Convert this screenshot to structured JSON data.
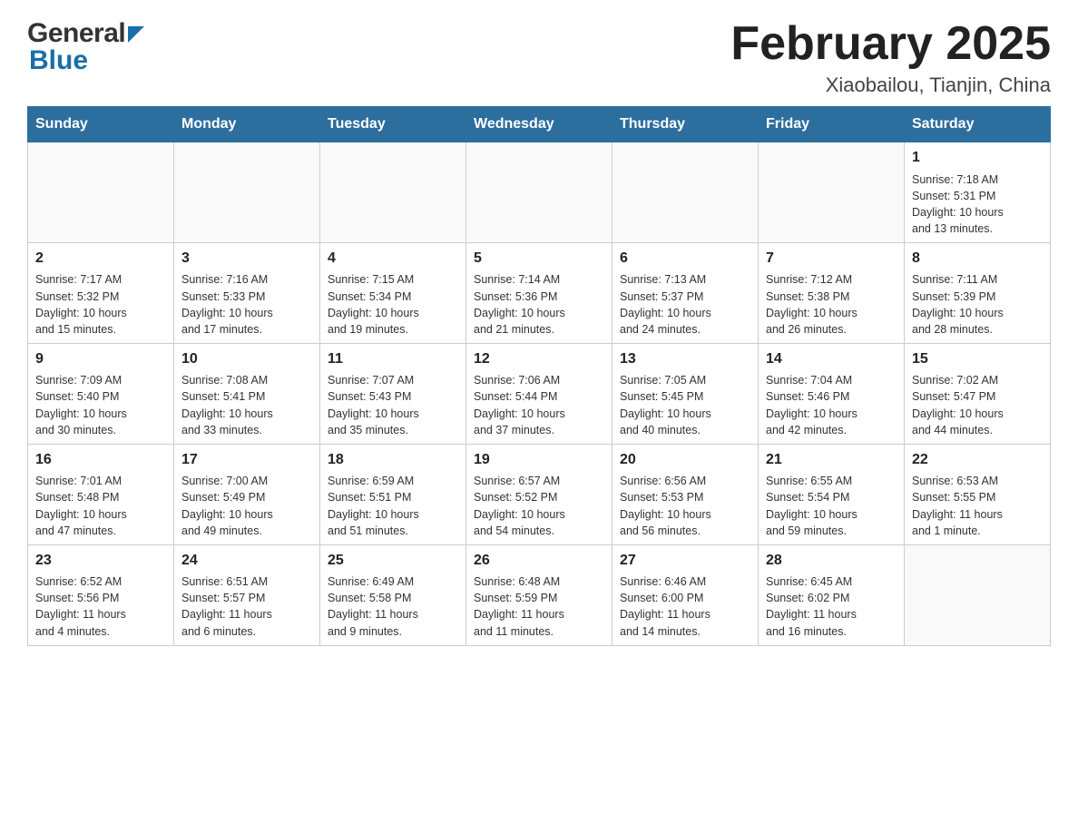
{
  "logo": {
    "general": "General",
    "blue": "Blue"
  },
  "header": {
    "title": "February 2025",
    "subtitle": "Xiaobailou, Tianjin, China"
  },
  "weekdays": [
    "Sunday",
    "Monday",
    "Tuesday",
    "Wednesday",
    "Thursday",
    "Friday",
    "Saturday"
  ],
  "weeks": [
    [
      {
        "day": "",
        "info": ""
      },
      {
        "day": "",
        "info": ""
      },
      {
        "day": "",
        "info": ""
      },
      {
        "day": "",
        "info": ""
      },
      {
        "day": "",
        "info": ""
      },
      {
        "day": "",
        "info": ""
      },
      {
        "day": "1",
        "info": "Sunrise: 7:18 AM\nSunset: 5:31 PM\nDaylight: 10 hours\nand 13 minutes."
      }
    ],
    [
      {
        "day": "2",
        "info": "Sunrise: 7:17 AM\nSunset: 5:32 PM\nDaylight: 10 hours\nand 15 minutes."
      },
      {
        "day": "3",
        "info": "Sunrise: 7:16 AM\nSunset: 5:33 PM\nDaylight: 10 hours\nand 17 minutes."
      },
      {
        "day": "4",
        "info": "Sunrise: 7:15 AM\nSunset: 5:34 PM\nDaylight: 10 hours\nand 19 minutes."
      },
      {
        "day": "5",
        "info": "Sunrise: 7:14 AM\nSunset: 5:36 PM\nDaylight: 10 hours\nand 21 minutes."
      },
      {
        "day": "6",
        "info": "Sunrise: 7:13 AM\nSunset: 5:37 PM\nDaylight: 10 hours\nand 24 minutes."
      },
      {
        "day": "7",
        "info": "Sunrise: 7:12 AM\nSunset: 5:38 PM\nDaylight: 10 hours\nand 26 minutes."
      },
      {
        "day": "8",
        "info": "Sunrise: 7:11 AM\nSunset: 5:39 PM\nDaylight: 10 hours\nand 28 minutes."
      }
    ],
    [
      {
        "day": "9",
        "info": "Sunrise: 7:09 AM\nSunset: 5:40 PM\nDaylight: 10 hours\nand 30 minutes."
      },
      {
        "day": "10",
        "info": "Sunrise: 7:08 AM\nSunset: 5:41 PM\nDaylight: 10 hours\nand 33 minutes."
      },
      {
        "day": "11",
        "info": "Sunrise: 7:07 AM\nSunset: 5:43 PM\nDaylight: 10 hours\nand 35 minutes."
      },
      {
        "day": "12",
        "info": "Sunrise: 7:06 AM\nSunset: 5:44 PM\nDaylight: 10 hours\nand 37 minutes."
      },
      {
        "day": "13",
        "info": "Sunrise: 7:05 AM\nSunset: 5:45 PM\nDaylight: 10 hours\nand 40 minutes."
      },
      {
        "day": "14",
        "info": "Sunrise: 7:04 AM\nSunset: 5:46 PM\nDaylight: 10 hours\nand 42 minutes."
      },
      {
        "day": "15",
        "info": "Sunrise: 7:02 AM\nSunset: 5:47 PM\nDaylight: 10 hours\nand 44 minutes."
      }
    ],
    [
      {
        "day": "16",
        "info": "Sunrise: 7:01 AM\nSunset: 5:48 PM\nDaylight: 10 hours\nand 47 minutes."
      },
      {
        "day": "17",
        "info": "Sunrise: 7:00 AM\nSunset: 5:49 PM\nDaylight: 10 hours\nand 49 minutes."
      },
      {
        "day": "18",
        "info": "Sunrise: 6:59 AM\nSunset: 5:51 PM\nDaylight: 10 hours\nand 51 minutes."
      },
      {
        "day": "19",
        "info": "Sunrise: 6:57 AM\nSunset: 5:52 PM\nDaylight: 10 hours\nand 54 minutes."
      },
      {
        "day": "20",
        "info": "Sunrise: 6:56 AM\nSunset: 5:53 PM\nDaylight: 10 hours\nand 56 minutes."
      },
      {
        "day": "21",
        "info": "Sunrise: 6:55 AM\nSunset: 5:54 PM\nDaylight: 10 hours\nand 59 minutes."
      },
      {
        "day": "22",
        "info": "Sunrise: 6:53 AM\nSunset: 5:55 PM\nDaylight: 11 hours\nand 1 minute."
      }
    ],
    [
      {
        "day": "23",
        "info": "Sunrise: 6:52 AM\nSunset: 5:56 PM\nDaylight: 11 hours\nand 4 minutes."
      },
      {
        "day": "24",
        "info": "Sunrise: 6:51 AM\nSunset: 5:57 PM\nDaylight: 11 hours\nand 6 minutes."
      },
      {
        "day": "25",
        "info": "Sunrise: 6:49 AM\nSunset: 5:58 PM\nDaylight: 11 hours\nand 9 minutes."
      },
      {
        "day": "26",
        "info": "Sunrise: 6:48 AM\nSunset: 5:59 PM\nDaylight: 11 hours\nand 11 minutes."
      },
      {
        "day": "27",
        "info": "Sunrise: 6:46 AM\nSunset: 6:00 PM\nDaylight: 11 hours\nand 14 minutes."
      },
      {
        "day": "28",
        "info": "Sunrise: 6:45 AM\nSunset: 6:02 PM\nDaylight: 11 hours\nand 16 minutes."
      },
      {
        "day": "",
        "info": ""
      }
    ]
  ]
}
